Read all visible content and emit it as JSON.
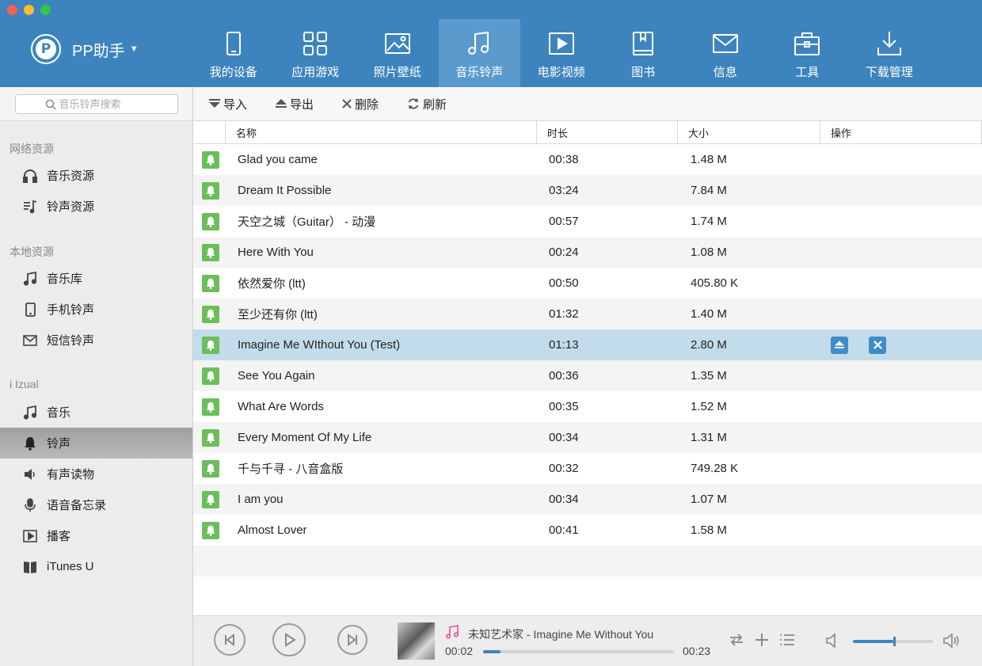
{
  "app": {
    "name": "PP助手"
  },
  "nav": [
    {
      "label": "我的设备",
      "icon": "device-icon"
    },
    {
      "label": "应用游戏",
      "icon": "apps-icon"
    },
    {
      "label": "照片壁纸",
      "icon": "photo-icon"
    },
    {
      "label": "音乐铃声",
      "icon": "music-icon",
      "active": true
    },
    {
      "label": "电影视频",
      "icon": "video-icon"
    },
    {
      "label": "图书",
      "icon": "book-icon"
    },
    {
      "label": "信息",
      "icon": "message-icon"
    },
    {
      "label": "工具",
      "icon": "toolbox-icon"
    },
    {
      "label": "下载管理",
      "icon": "download-icon"
    }
  ],
  "search": {
    "placeholder": "音乐铃声搜索"
  },
  "sidebar": {
    "sections": [
      {
        "title": "网络资源",
        "items": [
          {
            "label": "音乐资源",
            "icon": "headphones-icon"
          },
          {
            "label": "铃声资源",
            "icon": "music-list-icon"
          }
        ]
      },
      {
        "title": "本地资源",
        "items": [
          {
            "label": "音乐库",
            "icon": "music-note-icon"
          },
          {
            "label": "手机铃声",
            "icon": "phone-icon"
          },
          {
            "label": "短信铃声",
            "icon": "envelope-icon"
          }
        ]
      },
      {
        "title": "i Izual",
        "items": [
          {
            "label": "音乐",
            "icon": "music-note-icon"
          },
          {
            "label": "铃声",
            "icon": "bell-icon",
            "active": true
          },
          {
            "label": "有声读物",
            "icon": "speaker-icon"
          },
          {
            "label": "语音备忘录",
            "icon": "microphone-icon"
          },
          {
            "label": "播客",
            "icon": "podcast-icon"
          },
          {
            "label": "iTunes U",
            "icon": "itunes-u-icon"
          }
        ]
      }
    ]
  },
  "toolbar": {
    "import": "导入",
    "export": "导出",
    "delete": "删除",
    "refresh": "刷新"
  },
  "table": {
    "headers": {
      "name": "名称",
      "duration": "时长",
      "size": "大小",
      "ops": "操作"
    },
    "rows": [
      {
        "name": "Glad you came",
        "duration": "00:38",
        "size": "1.48 M"
      },
      {
        "name": "Dream It Possible",
        "duration": "03:24",
        "size": "7.84 M"
      },
      {
        "name": "天空之城（Guitar） - 动漫",
        "duration": "00:57",
        "size": "1.74 M"
      },
      {
        "name": "Here With You",
        "duration": "00:24",
        "size": "1.08 M"
      },
      {
        "name": "依然爱你 (ltt)",
        "duration": "00:50",
        "size": "405.80 K"
      },
      {
        "name": "至少还有你 (ltt)",
        "duration": "01:32",
        "size": "1.40 M"
      },
      {
        "name": "Imagine Me WIthout You (Test)",
        "duration": "01:13",
        "size": "2.80 M",
        "selected": true
      },
      {
        "name": "See You Again",
        "duration": "00:36",
        "size": "1.35 M"
      },
      {
        "name": "What Are Words",
        "duration": "00:35",
        "size": "1.52 M"
      },
      {
        "name": "Every Moment Of My Life",
        "duration": "00:34",
        "size": "1.31 M"
      },
      {
        "name": "千与千寻 - 八音盒版",
        "duration": "00:32",
        "size": "749.28 K"
      },
      {
        "name": "I am you",
        "duration": "00:34",
        "size": "1.07 M"
      },
      {
        "name": "Almost Lover",
        "duration": "00:41",
        "size": "1.58 M"
      }
    ]
  },
  "player": {
    "track": "未知艺术家 - Imagine Me Without You",
    "current": "00:02",
    "total": "00:23",
    "progress": 0.09,
    "volume": 0.5
  },
  "colors": {
    "header": "#3d84be",
    "bell": "#6cbe5b",
    "selected_row": "#c3dceb",
    "accent": "#3f8dc7"
  }
}
